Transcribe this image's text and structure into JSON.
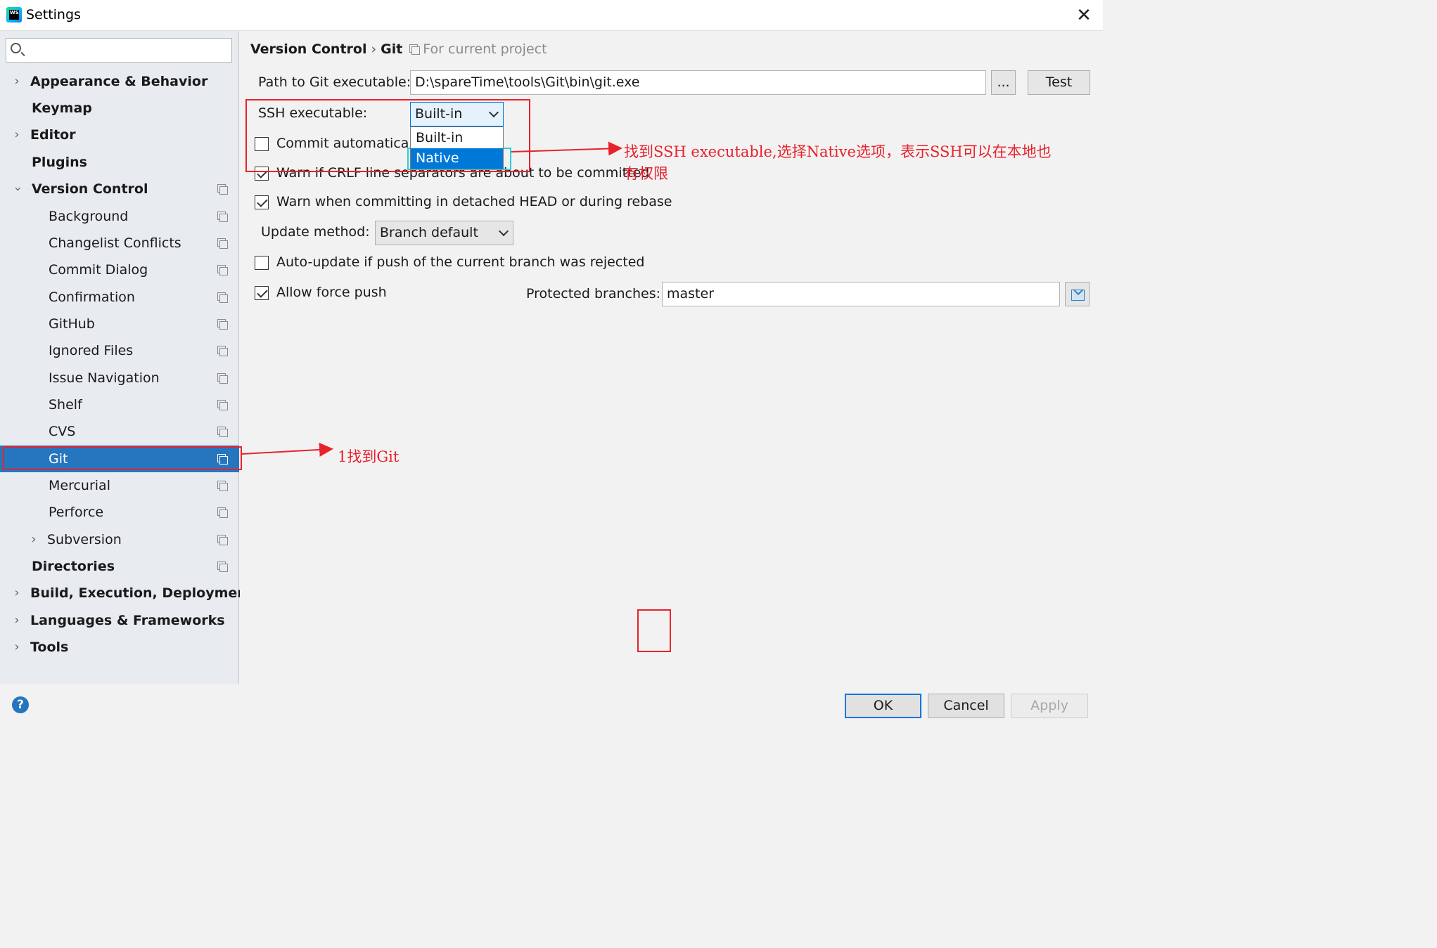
{
  "window": {
    "title": "Settings",
    "app_icon_text": "WS",
    "close_glyph": "✕"
  },
  "sidebar": {
    "search_placeholder": "",
    "items": [
      {
        "label": "Appearance & Behavior",
        "bold": true,
        "expandable": true,
        "expanded": false
      },
      {
        "label": "Keymap",
        "bold": true
      },
      {
        "label": "Editor",
        "bold": true,
        "expandable": true,
        "expanded": false
      },
      {
        "label": "Plugins",
        "bold": true
      },
      {
        "label": "Version Control",
        "bold": true,
        "expandable": true,
        "expanded": true,
        "project_icon": true
      },
      {
        "label": "Background",
        "project_icon": true
      },
      {
        "label": "Changelist Conflicts",
        "project_icon": true
      },
      {
        "label": "Commit Dialog",
        "project_icon": true
      },
      {
        "label": "Confirmation",
        "project_icon": true
      },
      {
        "label": "GitHub",
        "project_icon": true
      },
      {
        "label": "Ignored Files",
        "project_icon": true
      },
      {
        "label": "Issue Navigation",
        "project_icon": true
      },
      {
        "label": "Shelf",
        "project_icon": true
      },
      {
        "label": "CVS",
        "project_icon": true
      },
      {
        "label": "Git",
        "project_icon": true,
        "selected": true
      },
      {
        "label": "Mercurial",
        "project_icon": true
      },
      {
        "label": "Perforce",
        "project_icon": true
      },
      {
        "label": "Subversion",
        "expandable": true,
        "expanded": false,
        "project_icon": true
      },
      {
        "label": "Directories",
        "bold": true,
        "project_icon": true
      },
      {
        "label": "Build, Execution, Deployment",
        "bold": true,
        "expandable": true,
        "expanded": false
      },
      {
        "label": "Languages & Frameworks",
        "bold": true,
        "expandable": true,
        "expanded": false
      },
      {
        "label": "Tools",
        "bold": true,
        "expandable": true,
        "expanded": false
      }
    ]
  },
  "main": {
    "breadcrumb": {
      "parent": "Version Control",
      "separator": "›",
      "current": "Git",
      "scope": "For current project"
    },
    "git_path": {
      "label": "Path to Git executable:",
      "value": "D:\\spareTime\\tools\\Git\\bin\\git.exe",
      "browse_label": "...",
      "test_label": "Test"
    },
    "ssh": {
      "label": "SSH executable:",
      "selected": "Built-in",
      "options": [
        "Built-in",
        "Native"
      ],
      "highlighted_option": "Native"
    },
    "commit_auto": {
      "label": "Commit automatically",
      "checked": false
    },
    "warn_crlf": {
      "label": "Warn if CRLF line separators are about to be committed",
      "checked": true
    },
    "warn_detached": {
      "label": "Warn when committing in detached HEAD or during rebase",
      "checked": true
    },
    "update_method": {
      "label": "Update method:",
      "value": "Branch default"
    },
    "auto_update": {
      "label": "Auto-update if push of the current branch was rejected",
      "checked": false
    },
    "force_push": {
      "label": "Allow force push",
      "checked": true
    },
    "protected_branches": {
      "label": "Protected branches:",
      "value": "master"
    }
  },
  "footer": {
    "help_glyph": "?",
    "ok_label": "OK",
    "cancel_label": "Cancel",
    "apply_label": "Apply"
  },
  "annotations": {
    "step1": "1找到Git",
    "step2_line1": "找到SSH executable,选择Native选项，表示SSH可以在本地也",
    "step2_line2": "有权限",
    "color": "#e8222b"
  }
}
